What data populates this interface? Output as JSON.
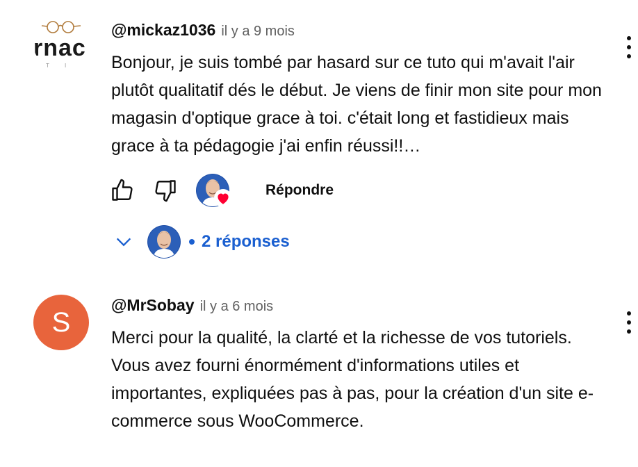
{
  "comments": [
    {
      "author": "@mickaz1036",
      "time": "il y a 9 mois",
      "avatar": {
        "logo_text": "rnac",
        "sub": "T I O"
      },
      "text": "Bonjour, je suis tombé par hasard sur ce tuto qui m'avait l'air plutôt qualitatif dés le début. Je viens de finir mon site pour mon magasin d'optique grace à toi. c'était long et fastidieux mais grace à ta pédagogie j'ai enfin réussi!!…",
      "reply_label": "Répondre",
      "replies_label": "2 réponses"
    },
    {
      "author": "@MrSobay",
      "time": "il y a 6 mois",
      "avatar": {
        "letter": "S",
        "color": "#e8643c"
      },
      "text": "Merci pour la qualité, la clarté et la richesse de vos tutoriels. Vous avez fourni énormément d'informations utiles et importantes, expliquées pas à pas, pour la création d'un site e-commerce sous WooCommerce."
    }
  ],
  "colors": {
    "link": "#1a5fd0",
    "heart": "#ff0033",
    "text": "#0f0f0f",
    "meta": "#606060"
  }
}
